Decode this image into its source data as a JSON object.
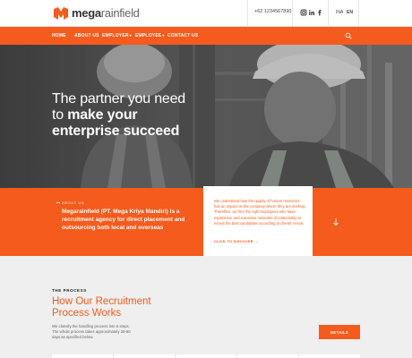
{
  "brand": {
    "name_bold": "mega",
    "name_light": "rainfield",
    "color": "#f45b1c"
  },
  "header": {
    "phone": "+62 1234567890",
    "social": [
      "instagram-icon",
      "linkedin-icon",
      "facebook-icon"
    ],
    "languages": [
      {
        "label": "INA",
        "active": false
      },
      {
        "label": "EN",
        "active": true
      }
    ]
  },
  "nav": {
    "items": [
      {
        "label": "HOME",
        "caret": false
      },
      {
        "label": "ABOUT US",
        "caret": false
      },
      {
        "label": "EMPLOYER",
        "caret": true
      },
      {
        "label": "EMPLOYEE",
        "caret": true
      },
      {
        "label": "CONTACT US",
        "caret": false
      }
    ],
    "search_icon": "search-icon"
  },
  "hero": {
    "line1": "The partner you need",
    "line2_prefix": "to ",
    "line2_bold": "make your",
    "line3_bold": "enterprise succeed"
  },
  "about": {
    "label": "ABOUT US",
    "text": "Megarainfield (PT. Mega Kriya Mandiri) is a recruitment agency for direct placement and outsourcing both local and overseas"
  },
  "card": {
    "text": "We understand how the quality of human resources has an impact on the company where they are working. Therefore, we hire the right employees who have experience and extensive networks of relationship to recruit the best candidates according to clients' needs.",
    "link": "CLICK TO DISCOVER →"
  },
  "process": {
    "label": "THE PROCESS",
    "title": "How Our Recruitment Process Works",
    "description": "We classify the handling process into 5 steps. The whole process takes approximately 30-60 days as specified below.",
    "button": "DETAILS"
  }
}
